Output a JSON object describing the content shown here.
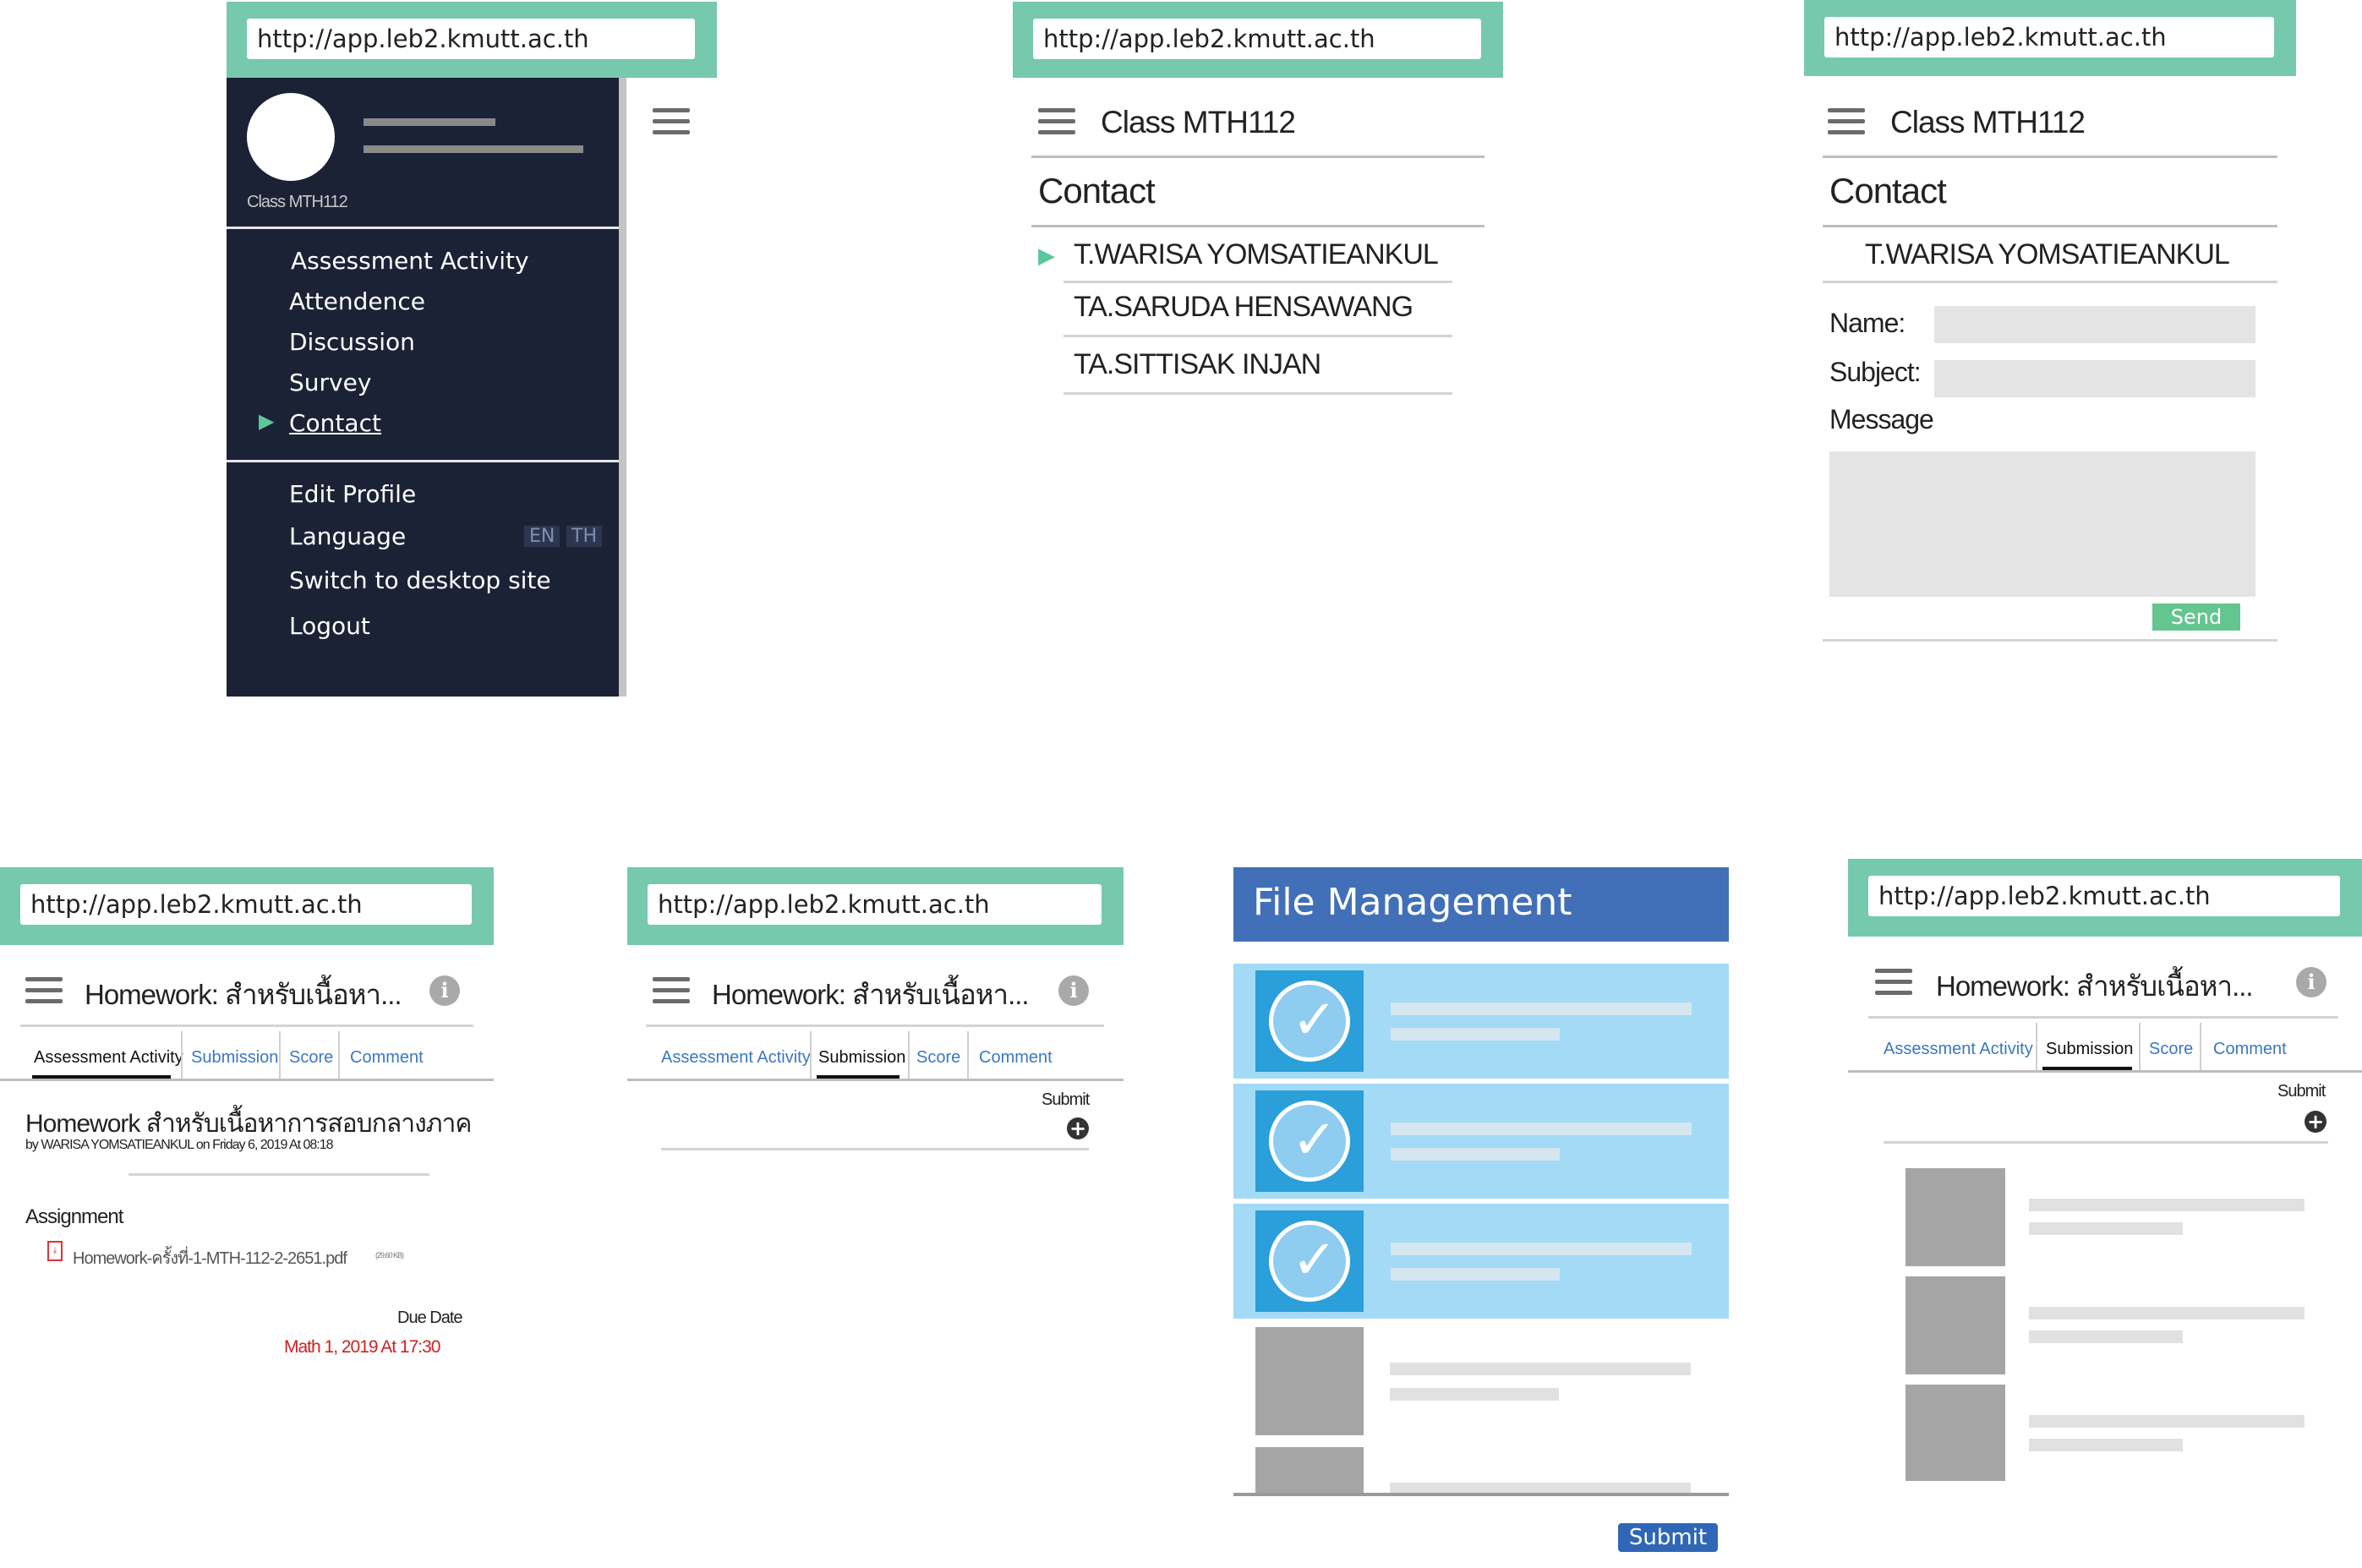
{
  "url": "http://app.leb2.kmutt.ac.th",
  "class_title": "Class MTH112",
  "drawer": {
    "class_label": "Class MTH112",
    "items": [
      {
        "label": "Assessment Activity",
        "active": false
      },
      {
        "label": "Attendence",
        "active": false
      },
      {
        "label": "Discussion",
        "active": false
      },
      {
        "label": "Survey",
        "active": false
      },
      {
        "label": "Contact",
        "active": true
      }
    ],
    "settings": {
      "edit_profile": "Edit Profile",
      "language": "Language",
      "lang_en": "EN",
      "lang_th": "TH",
      "switch_desktop": "Switch to desktop site",
      "logout": "Logout"
    }
  },
  "contact": {
    "heading": "Contact",
    "people": [
      "T.WARISA  YOMSATIEANKUL",
      "TA.SARUDA  HENSAWANG",
      "TA.SITTISAK  INJAN"
    ]
  },
  "contact_form": {
    "name_label": "Name:",
    "subject_label": "Subject:",
    "message_label": "Message",
    "send": "Send"
  },
  "homework": {
    "title": "Homework: สำหรับเนื้อหา...",
    "info_icon": "info-icon",
    "tabs": [
      "Assessment Activity",
      "Submission",
      "Score",
      "Comment"
    ],
    "full_title": "Homework  สำหรับเนื้อหาการสอบกลางภาค",
    "byline": "by  WARISA  YOMSATIEANKUL  on  Friday  6,  2019  At  08:18",
    "assignment_label": "Assignment",
    "file_name": "Homework-ครั้งที่-1-MTH-112-2-2651.pdf",
    "file_size": "(29.60 KB)",
    "due_label": "Due Date",
    "due_value": "Math  1,  2019  At  17:30",
    "submit_label": "Submit"
  },
  "file_management": {
    "title": "File Management",
    "submit": "Submit"
  },
  "colors": {
    "teal": "#76c9ad",
    "navy": "#1c2236",
    "blue_header": "#4170b8",
    "link_blue": "#3a78c2",
    "due_red": "#d32020",
    "send_green": "#63c58f"
  }
}
